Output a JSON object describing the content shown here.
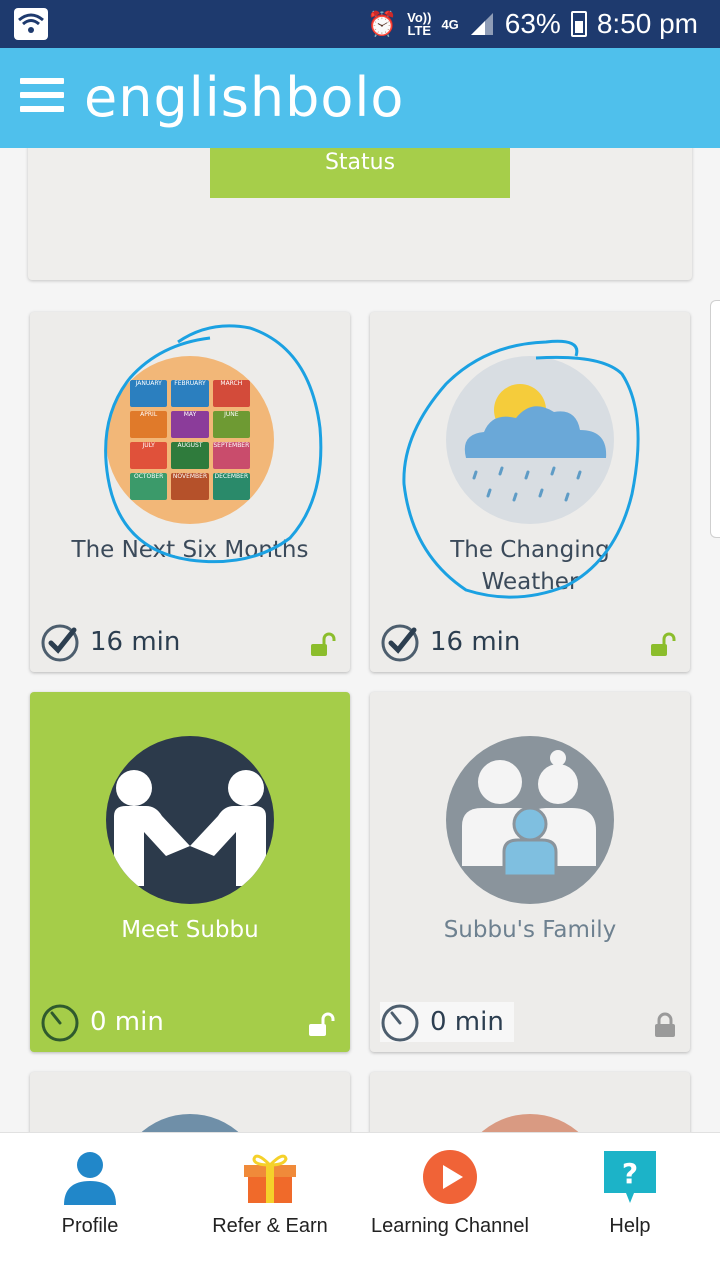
{
  "status_bar": {
    "volte_top": "Vo))",
    "volte_bottom": "LTE",
    "network": "4G",
    "battery": "63%",
    "time": "8:50 pm"
  },
  "app_bar": {
    "logo": "englishbolo"
  },
  "top_card": {
    "button_label": "Status"
  },
  "cards": [
    {
      "title": "The Next Six Months",
      "time": "16 min",
      "lock": "unlocked"
    },
    {
      "title": "The Changing Weather",
      "time": "16 min",
      "lock": "unlocked"
    },
    {
      "title": "Meet Subbu",
      "time": "0 min",
      "lock": "unlocked"
    },
    {
      "title": "Subbu's Family",
      "time": "0 min",
      "lock": "locked"
    }
  ],
  "calendar_months": [
    "JANUARY",
    "FEBRUARY",
    "MARCH",
    "APRIL",
    "MAY",
    "JUNE",
    "JULY",
    "AUGUST",
    "SEPTEMBER",
    "OCTOBER",
    "NOVEMBER",
    "DECEMBER"
  ],
  "bottom_nav": [
    {
      "label": "Profile",
      "icon": "profile-icon"
    },
    {
      "label": "Refer & Earn",
      "icon": "gift-icon"
    },
    {
      "label": "Learning Channel",
      "icon": "play-icon"
    },
    {
      "label": "Help",
      "icon": "help-icon"
    }
  ],
  "colors": {
    "status_bar": "#1e3a6e",
    "app_bar": "#4fc0ec",
    "accent_green": "#a6ce4a",
    "lock_green": "#8bbd2c",
    "scribble_blue": "#1ba1e2"
  }
}
